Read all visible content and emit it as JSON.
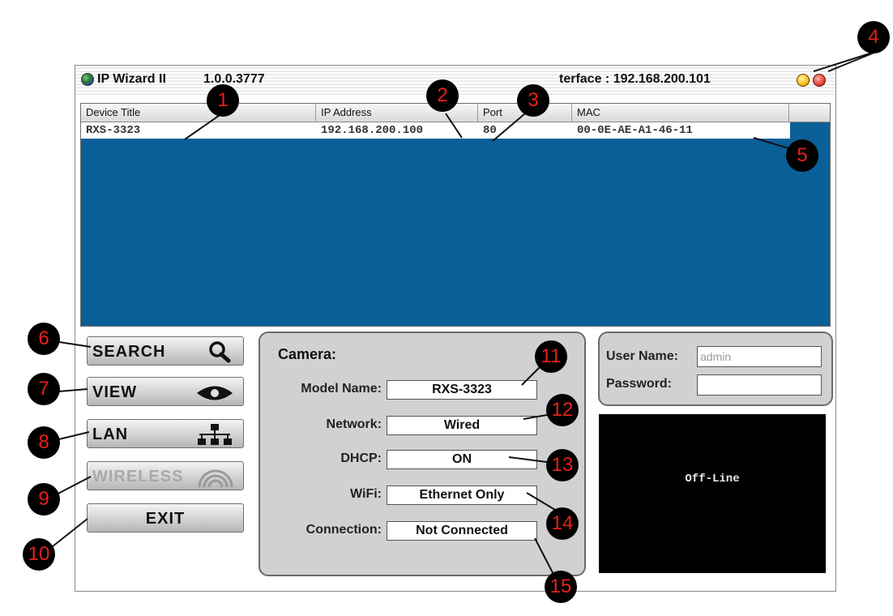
{
  "window": {
    "title": "IP Wizard II",
    "version_fragment": "1.0.0.3777",
    "interface_fragment": "terface : 192.168.200.101",
    "controls": [
      "minimize-button",
      "close-button"
    ],
    "control_colors": {
      "minimize": "#f6c21c",
      "close": "#e64a3c"
    }
  },
  "device_list": {
    "columns": [
      "Device Title",
      "IP Address",
      "Port",
      "MAC"
    ],
    "rows": [
      {
        "title": "RXS-3323",
        "ip": "192.168.200.100",
        "port": "80",
        "mac": "00-0E-AE-A1-46-11"
      }
    ],
    "background_color": "#0b5f98"
  },
  "buttons": {
    "search": {
      "label": "SEARCH",
      "icon": "magnifier-icon"
    },
    "view": {
      "label": "VIEW",
      "icon": "eye-icon"
    },
    "lan": {
      "label": "LAN",
      "icon": "network-tree-icon"
    },
    "wireless": {
      "label": "WIRELESS",
      "icon": "wifi-signal-icon",
      "state": "disabled"
    },
    "exit": {
      "label": "EXIT"
    }
  },
  "camera": {
    "title": "Camera:",
    "fields": [
      {
        "label": "Model Name:",
        "value": "RXS-3323"
      },
      {
        "label": "Network:",
        "value": "Wired"
      },
      {
        "label": "DHCP:",
        "value": "ON"
      },
      {
        "label": "WiFi:",
        "value": "Ethernet Only"
      },
      {
        "label": "Connection:",
        "value": "Not Connected"
      }
    ]
  },
  "login": {
    "username_label": "User Name:",
    "username_value": "admin",
    "password_label": "Password:",
    "password_value": ""
  },
  "video": {
    "status": "Off-Line"
  },
  "callouts": [
    "1",
    "2",
    "3",
    "4",
    "5",
    "6",
    "7",
    "8",
    "9",
    "10",
    "11",
    "12",
    "13",
    "14",
    "15"
  ],
  "colors": {
    "callout_bg": "#000000",
    "callout_text": "#e8201a"
  }
}
